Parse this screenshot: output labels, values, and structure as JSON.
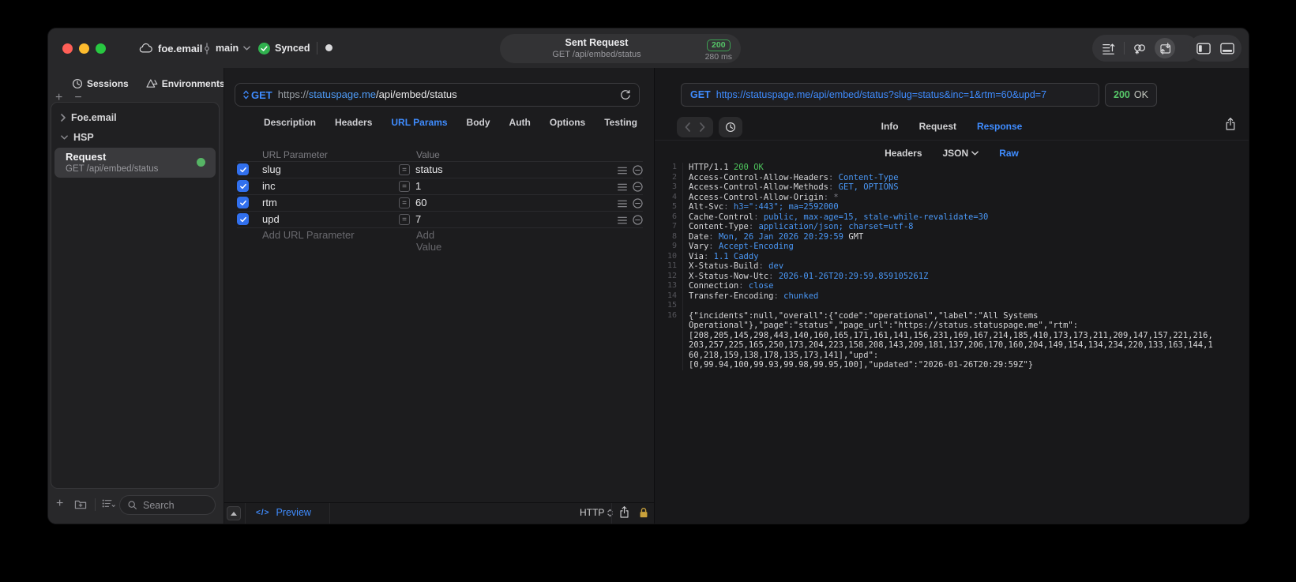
{
  "colors": {
    "accent_blue": "#3f8cff",
    "success_green": "#55c468",
    "checkbox_blue": "#3170ee",
    "lock_gold": "#c9a13b",
    "window_bg": "#28282a",
    "editor_bg": "#1c1c1e",
    "response_bg": "#18181a"
  },
  "titlebar": {
    "project": "foe.email",
    "branch": "main",
    "sync": "Synced",
    "request_pill": {
      "title": "Sent Request",
      "subtitle": "GET /api/embed/status",
      "status": "200",
      "time": "280 ms"
    }
  },
  "sidebar": {
    "tabs": [
      {
        "label": "Sessions"
      },
      {
        "label": "Environments"
      }
    ],
    "add_label": "+",
    "remove_label": "−",
    "tree": [
      {
        "label": "Foe.email",
        "state": "collapsed"
      },
      {
        "label": "HSP",
        "state": "expanded"
      }
    ],
    "request_item": {
      "title": "Request",
      "subtitle": "GET /api/embed/status"
    },
    "search_placeholder": "Search"
  },
  "request_editor": {
    "method": "GET",
    "url_scheme": "https://",
    "url_host": "statuspage.me",
    "url_path": "/api/embed/status",
    "tabs": [
      "Description",
      "Headers",
      "URL Params",
      "Body",
      "Auth",
      "Options",
      "Testing"
    ],
    "active_tab": "URL Params",
    "params_table": {
      "columns": [
        "URL Parameter",
        "Value"
      ],
      "rows": [
        {
          "enabled": true,
          "name": "slug",
          "value": "status"
        },
        {
          "enabled": true,
          "name": "inc",
          "value": "1"
        },
        {
          "enabled": true,
          "name": "rtm",
          "value": "60"
        },
        {
          "enabled": true,
          "name": "upd",
          "value": "7"
        }
      ],
      "add_name_placeholder": "Add URL Parameter",
      "add_value_placeholder": "Add Value"
    },
    "footer": {
      "code_glyph": "</>",
      "preview_label": "Preview",
      "protocol": "HTTP",
      "equals_glyph": "="
    }
  },
  "response_viewer": {
    "method": "GET",
    "url": "https://statuspage.me/api/embed/status?slug=status&inc=1&rtm=60&upd=7",
    "status_code": "200",
    "status_text": "OK",
    "tabs": [
      "Info",
      "Request",
      "Response"
    ],
    "active_tab": "Response",
    "format_tabs": [
      "Headers",
      "JSON",
      "Raw"
    ],
    "active_format": "Raw",
    "lines": [
      {
        "num": "1",
        "segs": [
          [
            "HTTP/1.1 ",
            "w"
          ],
          [
            "200 OK",
            "g"
          ]
        ]
      },
      {
        "num": "2",
        "segs": [
          [
            "Access-Control-Allow-Headers",
            "w"
          ],
          [
            ": ",
            "m"
          ],
          [
            "Content-Type",
            "b"
          ]
        ]
      },
      {
        "num": "3",
        "segs": [
          [
            "Access-Control-Allow-Methods",
            "w"
          ],
          [
            ": ",
            "m"
          ],
          [
            "GET, OPTIONS",
            "b"
          ]
        ]
      },
      {
        "num": "4",
        "segs": [
          [
            "Access-Control-Allow-Origin",
            "w"
          ],
          [
            ": ",
            "m"
          ],
          [
            "*",
            "m"
          ]
        ]
      },
      {
        "num": "5",
        "segs": [
          [
            "Alt-Svc",
            "w"
          ],
          [
            ": ",
            "m"
          ],
          [
            "h3=\":443\"; ma=2592000",
            "b"
          ]
        ]
      },
      {
        "num": "6",
        "segs": [
          [
            "Cache-Control",
            "w"
          ],
          [
            ": ",
            "m"
          ],
          [
            "public, max-age=15, stale-while-revalidate=30",
            "b"
          ]
        ]
      },
      {
        "num": "7",
        "segs": [
          [
            "Content-Type",
            "w"
          ],
          [
            ": ",
            "m"
          ],
          [
            "application/json; charset=utf-8",
            "b"
          ]
        ]
      },
      {
        "num": "8",
        "segs": [
          [
            "Date",
            "w"
          ],
          [
            ": ",
            "m"
          ],
          [
            "Mon, 26 Jan 2026 20:29:59",
            "b"
          ],
          [
            " GMT",
            "w"
          ]
        ]
      },
      {
        "num": "9",
        "segs": [
          [
            "Vary",
            "w"
          ],
          [
            ": ",
            "m"
          ],
          [
            "Accept-Encoding",
            "b"
          ]
        ]
      },
      {
        "num": "10",
        "segs": [
          [
            "Via",
            "w"
          ],
          [
            ": ",
            "m"
          ],
          [
            "1.1 Caddy",
            "b"
          ]
        ]
      },
      {
        "num": "11",
        "segs": [
          [
            "X-Status-Build",
            "w"
          ],
          [
            ": ",
            "m"
          ],
          [
            "dev",
            "b"
          ]
        ]
      },
      {
        "num": "12",
        "segs": [
          [
            "X-Status-Now-Utc",
            "w"
          ],
          [
            ": ",
            "m"
          ],
          [
            "2026-01-26T20:29:59.859105261Z",
            "b"
          ]
        ]
      },
      {
        "num": "13",
        "segs": [
          [
            "Connection",
            "w"
          ],
          [
            ": ",
            "m"
          ],
          [
            "close",
            "b"
          ]
        ]
      },
      {
        "num": "14",
        "segs": [
          [
            "Transfer-Encoding",
            "w"
          ],
          [
            ": ",
            "m"
          ],
          [
            "chunked",
            "b"
          ]
        ]
      },
      {
        "num": "15",
        "segs": []
      },
      {
        "num": "16",
        "segs": [
          [
            "{\"incidents\":null,\"overall\":{\"code\":\"operational\",\"label\":\"All Systems",
            "w"
          ]
        ]
      },
      {
        "num": "",
        "segs": [
          [
            "Operational\"},\"page\":\"status\",\"page_url\":\"https://status.statuspage.me\",\"rtm\":",
            "w"
          ]
        ]
      },
      {
        "num": "",
        "segs": [
          [
            "[208,205,145,298,443,140,160,165,171,161,141,156,231,169,167,214,185,410,173,173,211,209,147,157,221,216,",
            "w"
          ]
        ]
      },
      {
        "num": "",
        "segs": [
          [
            "203,257,225,165,250,173,204,223,158,208,143,209,181,137,206,170,160,204,149,154,134,234,220,133,163,144,1",
            "w"
          ]
        ]
      },
      {
        "num": "",
        "segs": [
          [
            "60,218,159,138,178,135,173,141],\"upd\":",
            "w"
          ]
        ]
      },
      {
        "num": "",
        "segs": [
          [
            "[0,99.94,100,99.93,99.98,99.95,100],\"updated\":\"2026-01-26T20:29:59Z\"}",
            "w"
          ]
        ]
      }
    ]
  },
  "icon_names": [
    "cloud-icon",
    "commit-icon",
    "chevron-down-icon",
    "check-circle-icon",
    "unsaved-dot-icon",
    "reorder-list-icon",
    "chain-sync-icon",
    "send-receive-icon",
    "layout-left-icon",
    "layout-bottom-icon",
    "history-icon",
    "environments-prism-icon",
    "add-icon",
    "remove-icon",
    "new-group-icon",
    "sort-list-icon",
    "search-icon",
    "method-picker-icon",
    "refresh-icon",
    "checkbox-check-icon",
    "equals-icon",
    "row-menu-icon",
    "remove-row-icon",
    "collapse-icon",
    "code-icon",
    "popup-arrows-icon",
    "share-icon",
    "lock-icon",
    "back-icon",
    "forward-icon",
    "clock-icon",
    "json-chevron-icon"
  ]
}
